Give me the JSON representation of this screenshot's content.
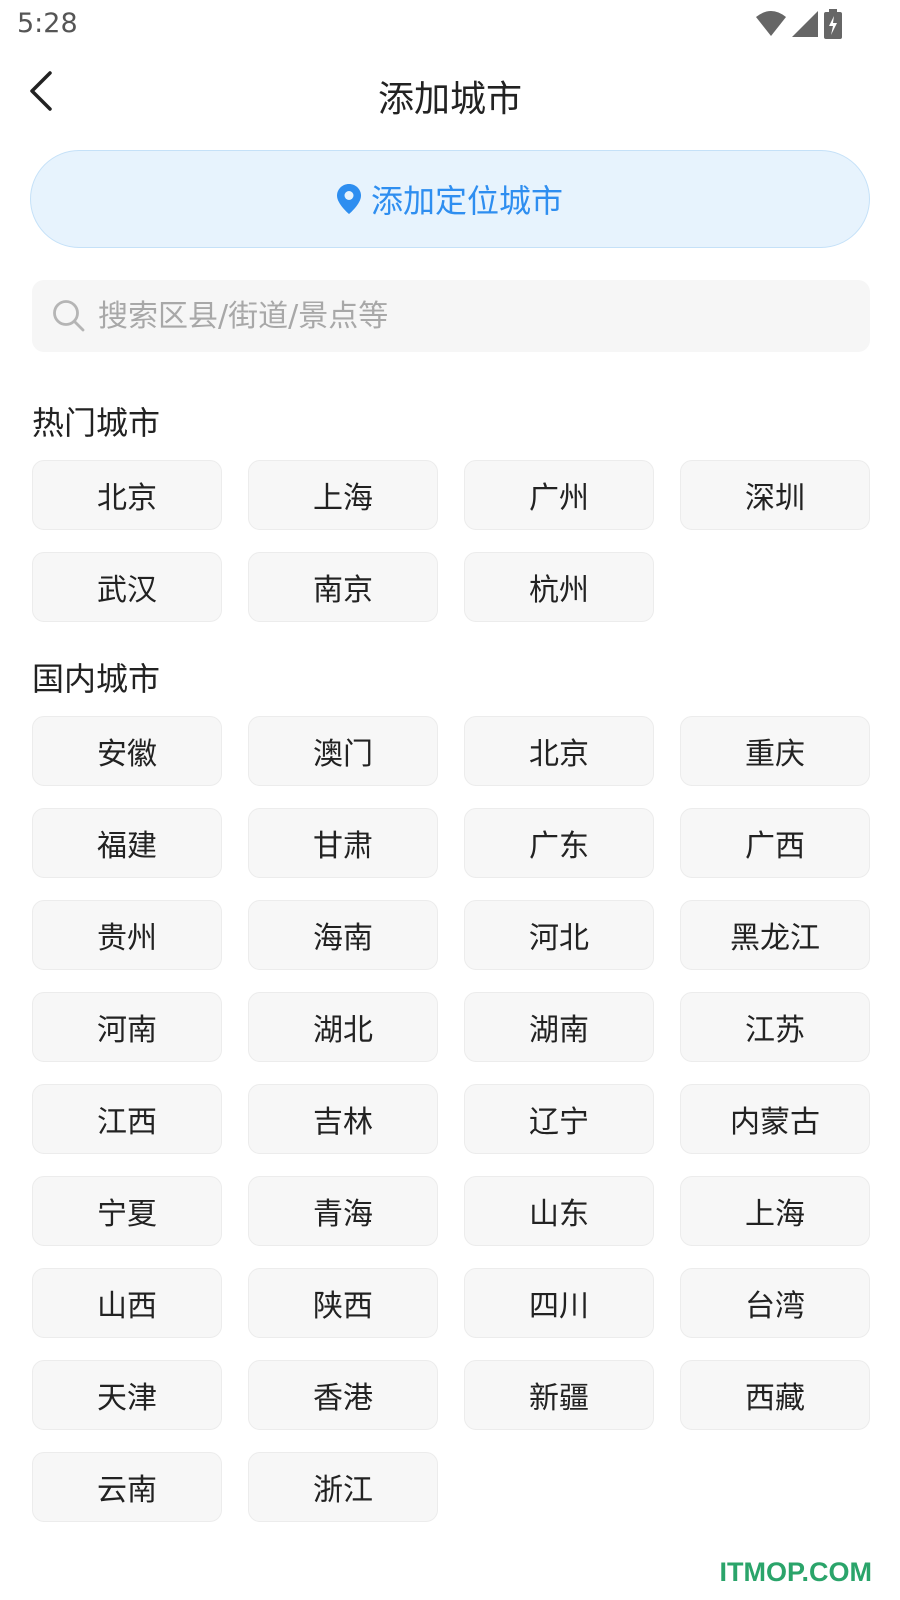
{
  "status_bar": {
    "time": "5:28",
    "icons": [
      "wifi-icon",
      "signal-icon",
      "battery-charging-icon"
    ]
  },
  "header": {
    "title": "添加城市",
    "back_icon": "chevron-left-icon"
  },
  "locate_button": {
    "label": "添加定位城市",
    "icon": "location-pin-icon",
    "accent": "#2e8ef0"
  },
  "search": {
    "placeholder": "搜索区县/街道/景点等",
    "value": "",
    "icon": "search-icon"
  },
  "hot_cities": {
    "title": "热门城市",
    "items": [
      "北京",
      "上海",
      "广州",
      "深圳",
      "武汉",
      "南京",
      "杭州"
    ]
  },
  "domestic_cities": {
    "title": "国内城市",
    "items": [
      "安徽",
      "澳门",
      "北京",
      "重庆",
      "福建",
      "甘肃",
      "广东",
      "广西",
      "贵州",
      "海南",
      "河北",
      "黑龙江",
      "河南",
      "湖北",
      "湖南",
      "江苏",
      "江西",
      "吉林",
      "辽宁",
      "内蒙古",
      "宁夏",
      "青海",
      "山东",
      "上海",
      "山西",
      "陕西",
      "四川",
      "台湾",
      "天津",
      "香港",
      "新疆",
      "西藏",
      "云南",
      "浙江"
    ]
  },
  "watermark": "ITMOP.COM"
}
